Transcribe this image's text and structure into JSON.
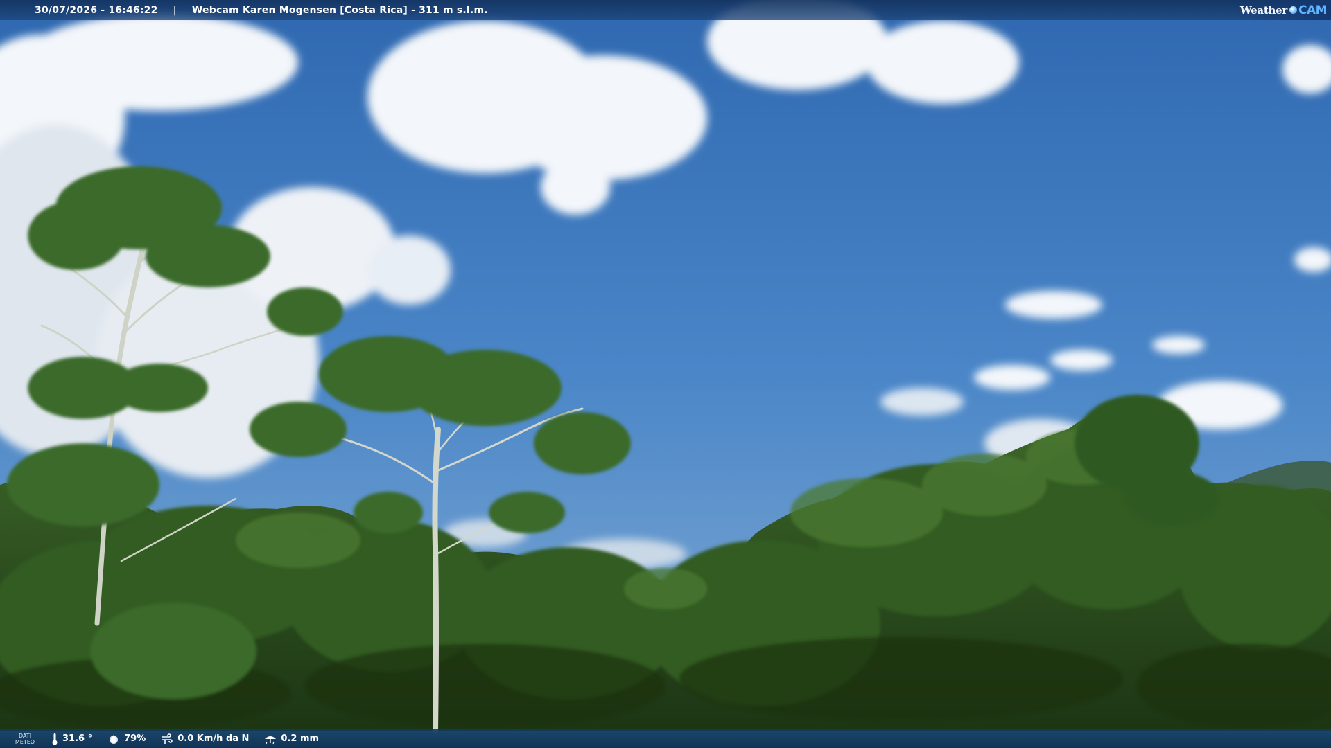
{
  "header": {
    "datetime": "30/07/2026 - 16:46:22",
    "separator": "|",
    "title": "Webcam Karen Mogensen [Costa Rica]  - 311 m s.l.m."
  },
  "logo": {
    "part1": "Weather",
    "part2": "CAM"
  },
  "footer": {
    "label": "DATI METEO",
    "temperature": "31.6 °",
    "humidity": "79%",
    "wind": "0.0 Km/h da N",
    "rain": "0.2 mm"
  },
  "colors": {
    "sky": "#3f7fc6",
    "foliage": "#2d4f1f",
    "bar": "#173e70"
  },
  "icons": [
    "thermometer-icon",
    "humidity-icon",
    "wind-icon",
    "rain-icon"
  ]
}
